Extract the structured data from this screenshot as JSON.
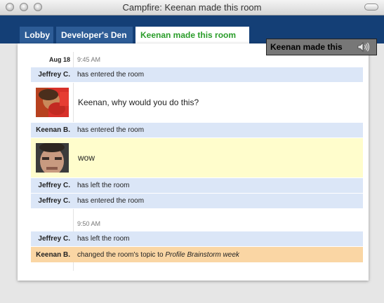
{
  "window": {
    "title": "Campfire: Keenan made this room"
  },
  "tabs": [
    {
      "label": "Lobby",
      "active": false
    },
    {
      "label": "Developer's Den",
      "active": false
    },
    {
      "label": "Keenan made this room",
      "active": true
    }
  ],
  "notice": {
    "text": "Keenan made this",
    "icon": "speaker-icon"
  },
  "messages": {
    "stamp1": {
      "date": "Aug 18",
      "time": "9:45 AM"
    },
    "m1": {
      "who": "Jeffrey C.",
      "text": "has entered the room"
    },
    "m2": {
      "who": "",
      "text": "Keenan, why would you do this?",
      "avatar": "avatar-red"
    },
    "m3": {
      "who": "Keenan B.",
      "text": "has entered the room"
    },
    "m4": {
      "who": "",
      "text": "wow",
      "avatar": "avatar-face"
    },
    "m5": {
      "who": "Jeffrey C.",
      "text": "has left the room"
    },
    "m6": {
      "who": "Jeffrey C.",
      "text": "has entered the room"
    },
    "stamp2": {
      "date": "",
      "time": "9:50 AM"
    },
    "m7": {
      "who": "Jeffrey C.",
      "text": "has left the room"
    },
    "m8": {
      "who": "Keenan B.",
      "text": "changed the room's topic to",
      "topic": "Profile Brainstorm week"
    }
  },
  "colors": {
    "tab_bar": "#143f76",
    "tab_inactive": "#2d5c96",
    "tab_active_text": "#2a9d2a",
    "enter_row": "#dbe6f7",
    "highlight_row": "#fffdcc",
    "topic_row": "#fad6a4"
  }
}
